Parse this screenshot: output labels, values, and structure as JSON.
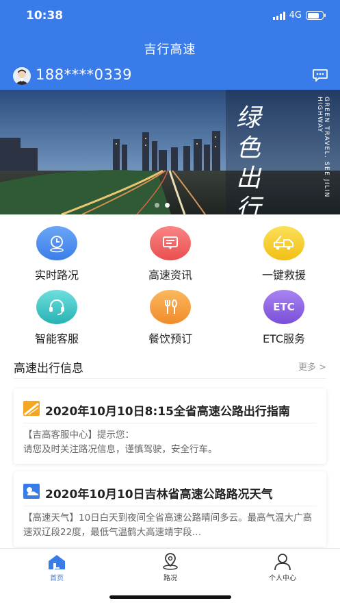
{
  "status_bar": {
    "time": "10:38",
    "network": "4G",
    "battery_level": 0.78
  },
  "header": {
    "title": "吉行高速",
    "phone": "188****0339"
  },
  "banner": {
    "slogan": "绿色出行",
    "side_text": "GREEN TRAVEL. SEE JILIN HIGHWAY",
    "slide_count": 2,
    "active_slide": 1
  },
  "services": [
    {
      "label": "实时路况",
      "icon": "clock-pin-icon",
      "color": "#4a8cf0"
    },
    {
      "label": "高速资讯",
      "icon": "news-screen-icon",
      "color": "#f05a5a"
    },
    {
      "label": "一键救援",
      "icon": "tow-truck-icon",
      "color": "#f5c61c"
    },
    {
      "label": "智能客服",
      "icon": "headset-icon",
      "color": "#33c3c3"
    },
    {
      "label": "餐饮预订",
      "icon": "cutlery-icon",
      "color": "#f59b3c"
    },
    {
      "label": "ETC服务",
      "icon": "etc-icon",
      "color": "#8e5fe0",
      "icon_text": "ETC"
    }
  ],
  "section": {
    "title": "高速出行信息",
    "more": "更多 >"
  },
  "news": [
    {
      "title": "2020年10月10日8:15全省高速公路出行指南",
      "body": "【吉高客服中心】提示您：\n请您及时关注路况信息，谨慎驾驶，安全行车。",
      "icon": "road-icon",
      "icon_color": "#f5a623"
    },
    {
      "title": "2020年10月10日吉林省高速公路路况天气",
      "body": "【高速天气】10日白天到夜间全省高速公路晴间多云。最高气温大广高速双辽段22度，最低气温鹤大高速靖宇段…",
      "icon": "weather-icon",
      "icon_color": "#3a7bea"
    }
  ],
  "tabbar": {
    "items": [
      {
        "label": "首页",
        "icon": "home-icon",
        "active": true
      },
      {
        "label": "路况",
        "icon": "map-pin-icon",
        "active": false
      },
      {
        "label": "个人中心",
        "icon": "person-icon",
        "active": false
      }
    ],
    "active_color": "#3a7bea"
  },
  "colors": {
    "primary": "#3a7bea"
  }
}
